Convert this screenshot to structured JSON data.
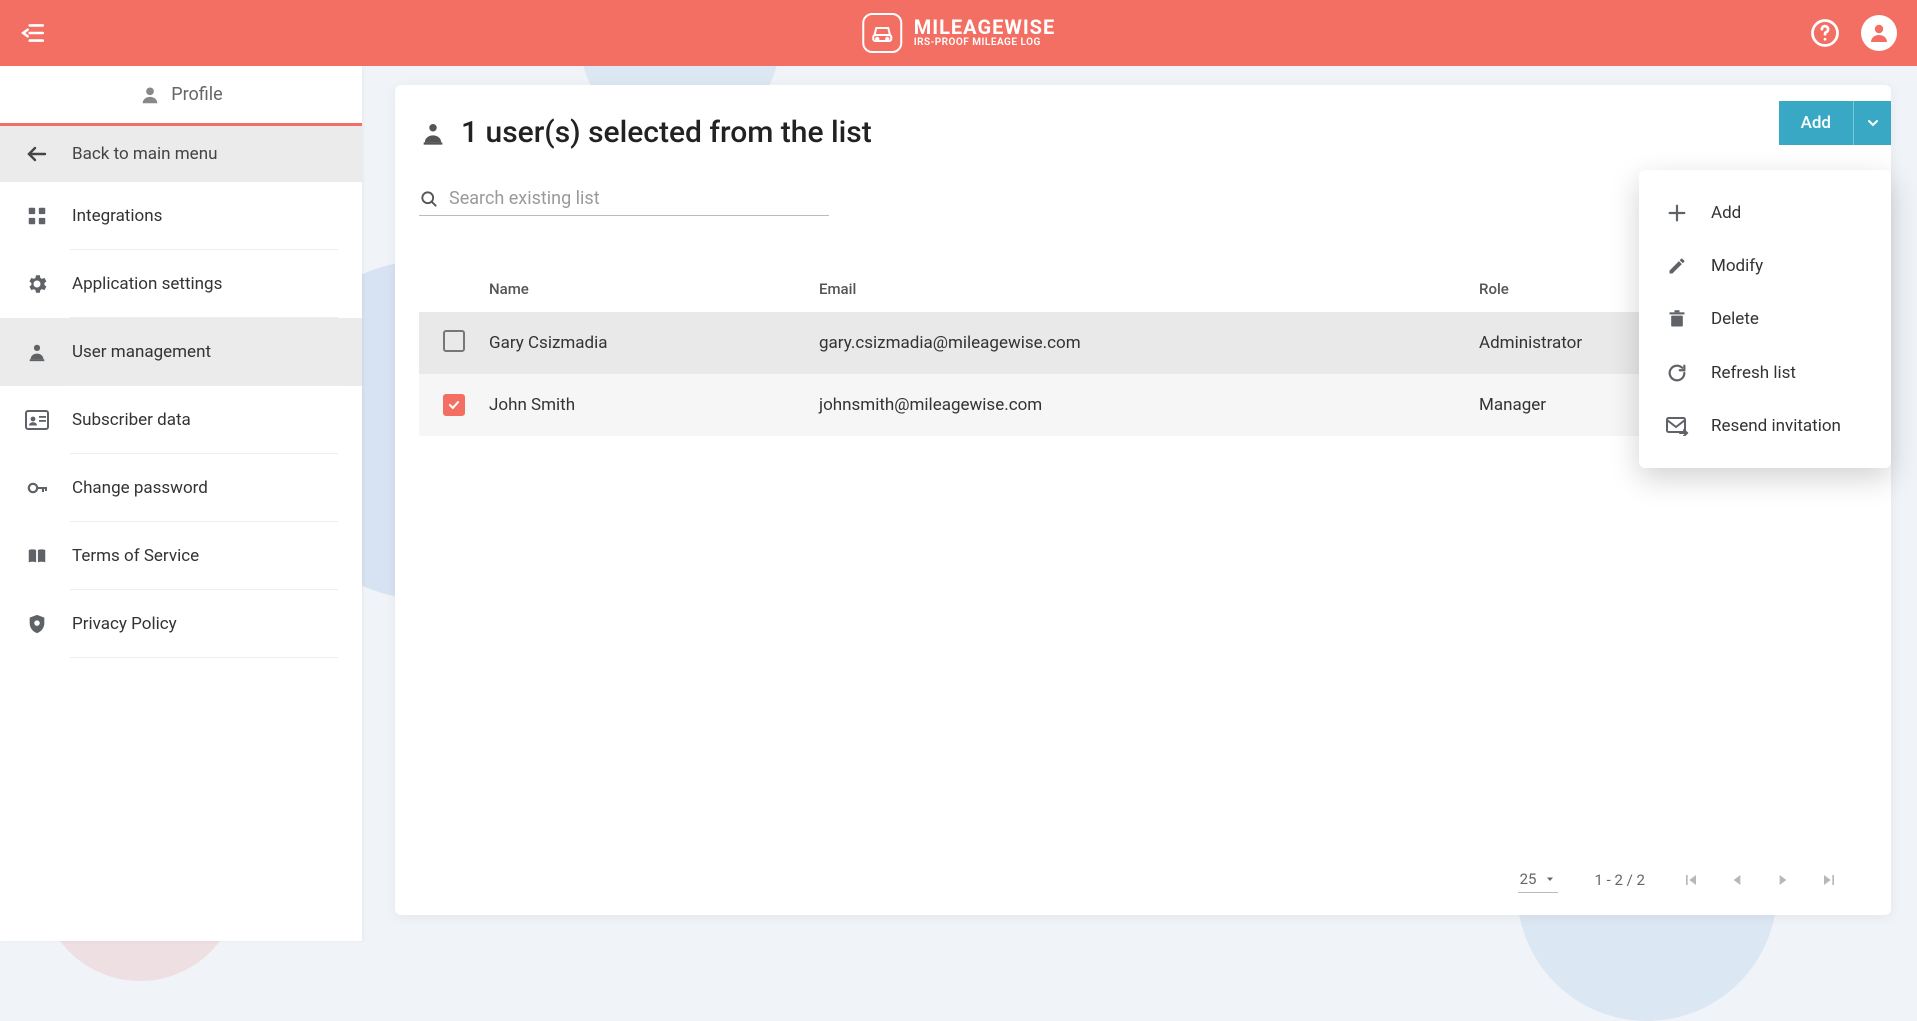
{
  "header": {
    "brand_line1": "MILEAGEWISE",
    "brand_line2": "IRS-PROOF MILEAGE LOG"
  },
  "sidebar": {
    "profile_label": "Profile",
    "back_label": "Back to main menu",
    "items": [
      {
        "label": "Integrations",
        "icon": "grid"
      },
      {
        "label": "Application settings",
        "icon": "gear"
      },
      {
        "label": "User management",
        "icon": "user",
        "active": true
      },
      {
        "label": "Subscriber data",
        "icon": "id"
      },
      {
        "label": "Change password",
        "icon": "key"
      },
      {
        "label": "Terms of Service",
        "icon": "book"
      },
      {
        "label": "Privacy Policy",
        "icon": "shield"
      }
    ]
  },
  "page": {
    "title": "1 user(s) selected from the list",
    "add_button": "Add",
    "search_placeholder": "Search existing list"
  },
  "table": {
    "columns": {
      "name": "Name",
      "email": "Email",
      "role": "Role"
    },
    "rows": [
      {
        "selected": false,
        "name": "Gary Csizmadia",
        "email": "gary.csizmadia@mileagewise.com",
        "role": "Administrator"
      },
      {
        "selected": true,
        "name": "John Smith",
        "email": "johnsmith@mileagewise.com",
        "role": "Manager"
      }
    ]
  },
  "pagination": {
    "page_size": "25",
    "range": "1 - 2 / 2"
  },
  "menu": {
    "items": [
      {
        "label": "Add",
        "icon": "plus"
      },
      {
        "label": "Modify",
        "icon": "pencil"
      },
      {
        "label": "Delete",
        "icon": "trash"
      },
      {
        "label": "Refresh list",
        "icon": "refresh"
      },
      {
        "label": "Resend invitation",
        "icon": "mail"
      }
    ]
  }
}
